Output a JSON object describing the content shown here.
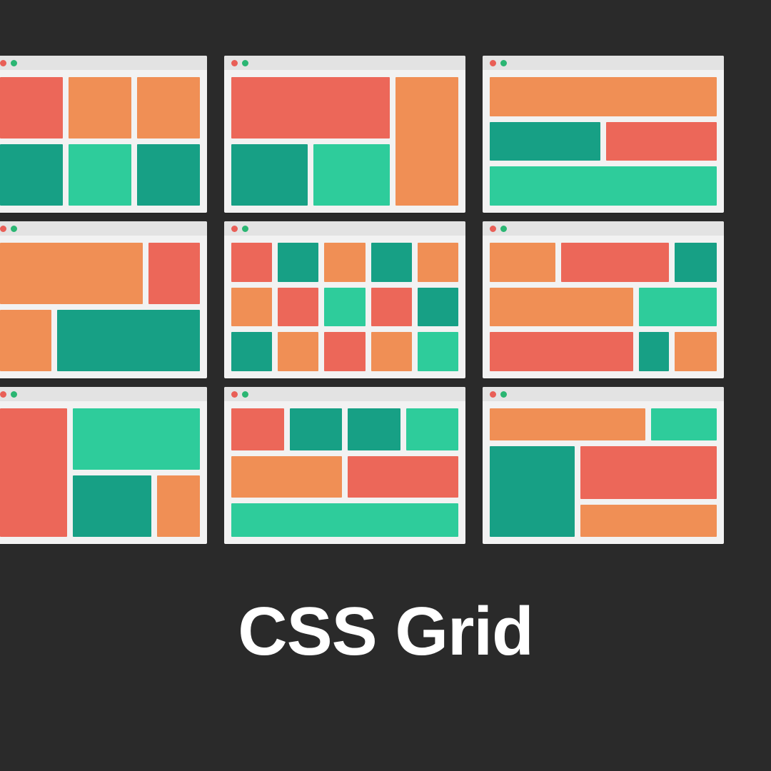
{
  "title": "CSS Grid",
  "colors": {
    "red": "#ec6759",
    "orange": "#f08f55",
    "teal": "#17a085",
    "mint": "#2ecc9b",
    "bg": "#2a2a2a",
    "window_bg": "#f2f2f2",
    "titlebar_bg": "#e3e3e3"
  },
  "grid": {
    "rows": 3,
    "cols": 3,
    "window_dots": [
      "red",
      "green"
    ]
  },
  "windows": [
    {
      "id": "1a",
      "cells": [
        "red",
        "orange",
        "orange",
        "teal",
        "mint",
        "teal"
      ]
    },
    {
      "id": "1b",
      "cells": [
        "red",
        "teal",
        "mint",
        "orange"
      ]
    },
    {
      "id": "1c",
      "cells": [
        "orange",
        "teal",
        "red",
        "mint"
      ]
    },
    {
      "id": "2a",
      "cells": [
        "orange",
        "red",
        "orange",
        "teal"
      ]
    },
    {
      "id": "2b",
      "cells": [
        "red",
        "teal",
        "orange",
        "teal",
        "orange",
        "orange",
        "red",
        "mint",
        "red",
        "teal",
        "teal",
        "orange",
        "red",
        "orange",
        "mint"
      ]
    },
    {
      "id": "2c",
      "cells": [
        "orange",
        "red",
        "teal",
        "orange",
        "mint",
        "red",
        "teal",
        "orange"
      ]
    },
    {
      "id": "3a",
      "cells": [
        "red",
        "mint",
        "teal",
        "orange"
      ]
    },
    {
      "id": "3b",
      "cells": [
        "red",
        "teal",
        "teal",
        "mint",
        "orange",
        "red",
        "mint"
      ]
    },
    {
      "id": "3c",
      "cells": [
        "orange",
        "mint",
        "teal",
        "red",
        "orange"
      ]
    }
  ]
}
